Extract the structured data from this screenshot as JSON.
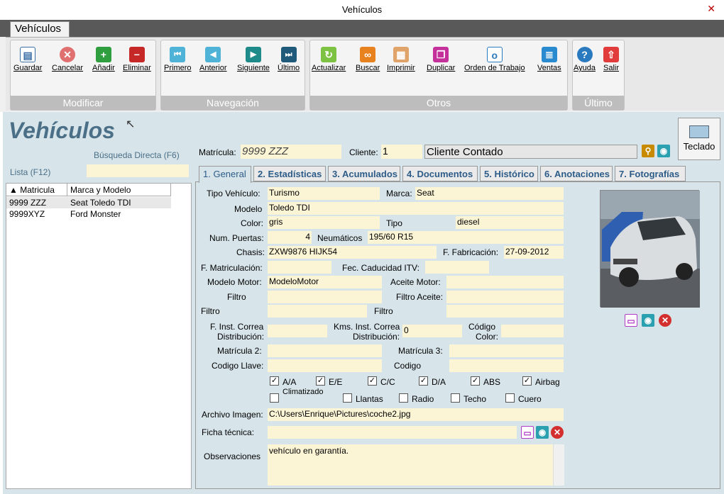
{
  "window": {
    "title": "Vehículos",
    "close": "✕"
  },
  "ribbon": {
    "tab": "Vehículos",
    "groups": {
      "modificar": "Modificar",
      "navegacion": "Navegación",
      "otros": "Otros",
      "ultimo": "Último"
    },
    "buttons": {
      "guardar": "Guardar",
      "cancelar": "Cancelar",
      "anadir": "Añadir",
      "eliminar": "Eliminar",
      "primero": "Primero",
      "anterior": "Anterior",
      "siguiente": "Siguiente",
      "ultimo": "Último",
      "actualizar": "Actualizar",
      "buscar": "Buscar",
      "imprimir": "Imprimir",
      "duplicar": "Duplicar",
      "orden": "Orden de Trabajo",
      "ventas": "Ventas",
      "ayuda": "Ayuda",
      "salir": "Salir"
    }
  },
  "page": {
    "title": "Vehículos",
    "busqueda": "Búsqueda Directa (F6)",
    "lista": "Lista (F12)",
    "teclado": "Teclado"
  },
  "list": {
    "headers": [
      "Matricula",
      "Marca y Modelo"
    ],
    "rows": [
      [
        "9999 ZZZ",
        "Seat Toledo TDI"
      ],
      [
        "9999XYZ",
        "Ford Monster"
      ]
    ]
  },
  "header": {
    "matricula_label": "Matrícula:",
    "matricula": "9999 ZZZ",
    "cliente_label": "Cliente:",
    "cliente": "1",
    "cliente_nombre": "Cliente Contado"
  },
  "tabs": [
    "1. General",
    "2. Estadísticas",
    "3. Acumulados",
    "4. Documentos",
    "5. Histórico",
    "6. Anotaciones",
    "7. Fotografías"
  ],
  "form": {
    "tipo_vehiculo_label": "Tipo Vehículo:",
    "tipo_vehiculo": "Turismo",
    "marca_label": "Marca:",
    "marca": "Seat",
    "modelo_label": "Modelo",
    "modelo": "Toledo TDI",
    "color_label": "Color:",
    "color": "gris",
    "tipo_label": "Tipo",
    "tipo": "diesel",
    "puertas_label": "Num. Puertas:",
    "puertas": "4",
    "neumaticos_label": "Neumáticos",
    "neumaticos": "195/60 R15",
    "chasis_label": "Chasis:",
    "chasis": "ZXW9876 HIJK54",
    "fabricacion_label": "F. Fabricación:",
    "fabricacion": "27-09-2012",
    "matriculacion_label": "F. Matriculación:",
    "itv_label": "Fec. Caducidad ITV:",
    "modelo_motor_label": "Modelo Motor:",
    "modelo_motor": "ModeloMotor",
    "aceite_label": "Aceite Motor:",
    "filtro_label": "Filtro",
    "filtro_aceite_label": "Filtro Aceite:",
    "filtro2_label": "Filtro",
    "filtro3_label": "Filtro",
    "correa_label1": "F. Inst. Correa",
    "correa_label2": "Distribución:",
    "kms_label1": "Kms. Inst. Correa",
    "kms_label2": "Distribución:",
    "kms": "0",
    "codigo_color_label1": "Código",
    "codigo_color_label2": "Color:",
    "matricula2_label": "Matrícula 2:",
    "matricula3_label": "Matrícula 3:",
    "codigo_llave_label": "Codigo Llave:",
    "codigo_label": "Codigo",
    "archivo_label": "Archivo Imagen:",
    "archivo": "C:\\Users\\Enrique\\Pictures\\coche2.jpg",
    "ficha_label": "Ficha técnica:",
    "obs_label": "Observaciones",
    "obs": "vehículo en garantía."
  },
  "checks": [
    {
      "label": "A/A",
      "checked": true
    },
    {
      "label": "E/E",
      "checked": true
    },
    {
      "label": "C/C",
      "checked": true
    },
    {
      "label": "D/A",
      "checked": true
    },
    {
      "label": "ABS",
      "checked": true
    },
    {
      "label": "Airbag",
      "checked": true
    },
    {
      "label": "Climatizado",
      "checked": false
    },
    {
      "label": "Llantas",
      "checked": false
    },
    {
      "label": "Radio",
      "checked": false
    },
    {
      "label": "Techo",
      "checked": false
    },
    {
      "label": "Cuero",
      "checked": false
    }
  ]
}
